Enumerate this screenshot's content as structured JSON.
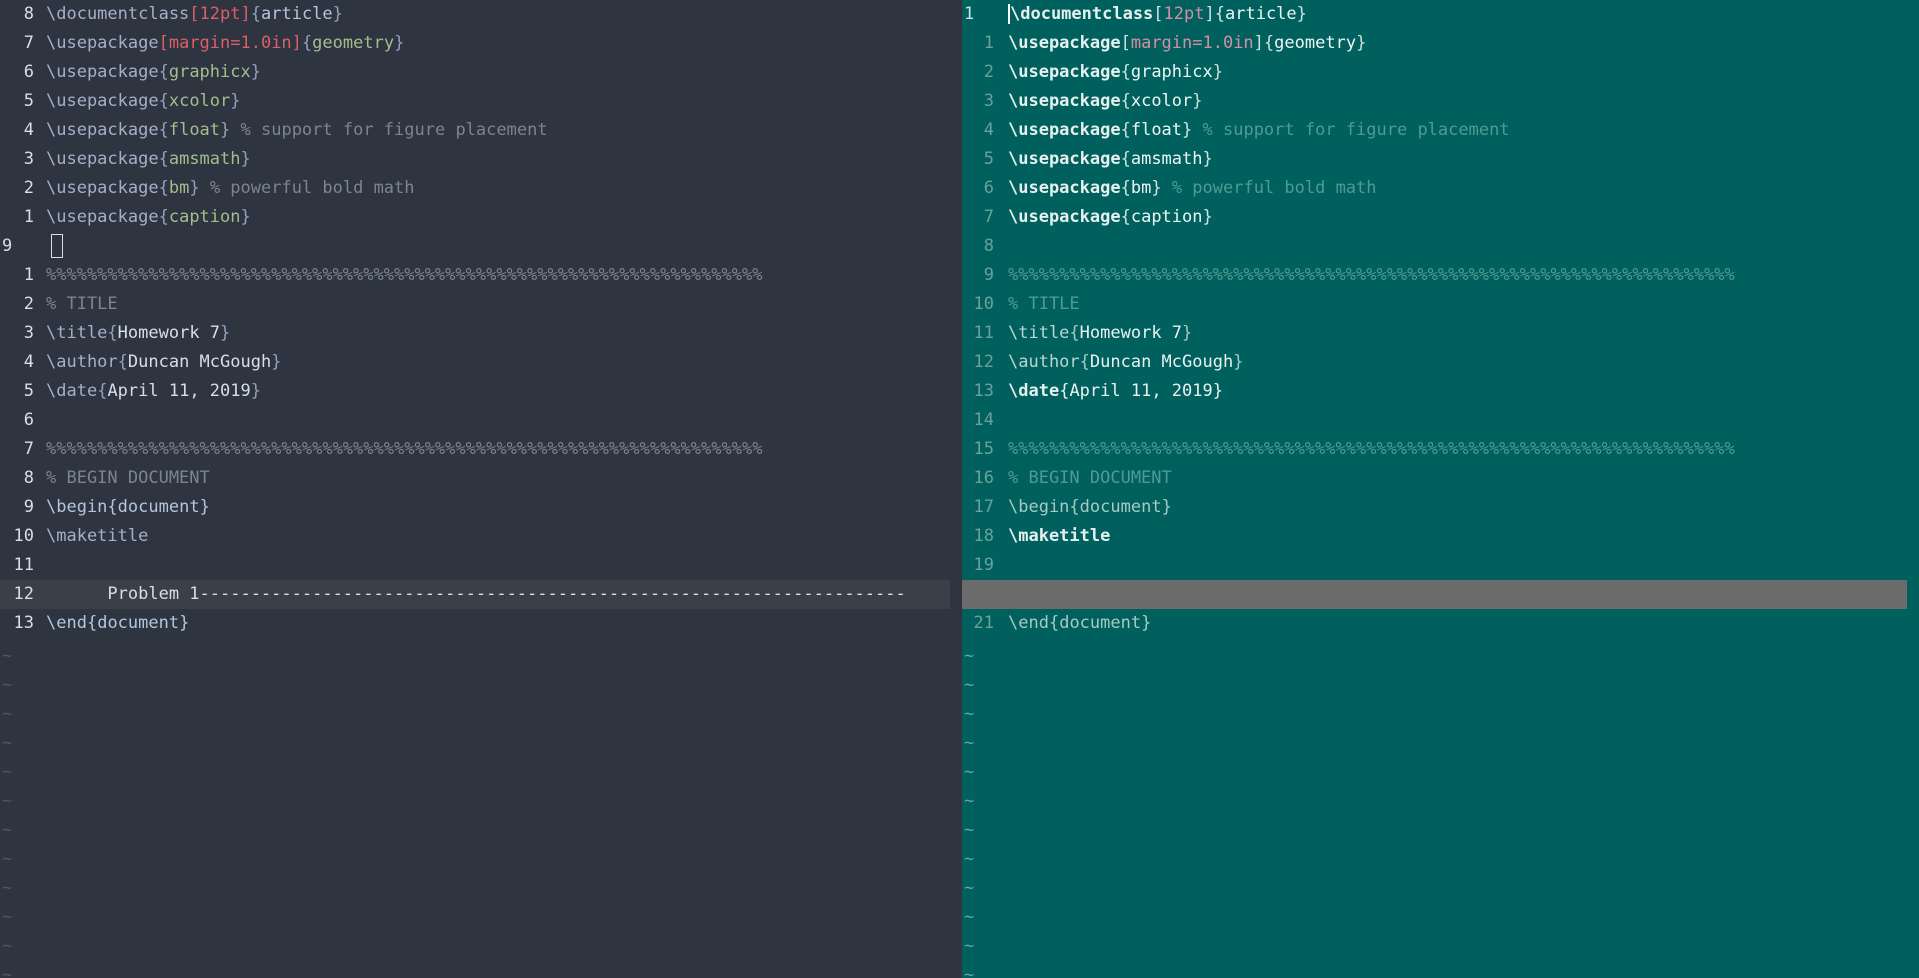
{
  "left_pane": {
    "lines": [
      {
        "num": "8",
        "kind": "pkg",
        "cmd": "\\documentclass",
        "opt": "12pt",
        "arg": "article"
      },
      {
        "num": "7",
        "kind": "pkg",
        "cmd": "\\usepackage",
        "opt": "margin=1.0in",
        "arg": "geometry"
      },
      {
        "num": "6",
        "kind": "pkg",
        "cmd": "\\usepackage",
        "arg": "graphicx"
      },
      {
        "num": "5",
        "kind": "pkg",
        "cmd": "\\usepackage",
        "arg": "xcolor"
      },
      {
        "num": "4",
        "kind": "pkg",
        "cmd": "\\usepackage",
        "arg": "float",
        "comment": "% support for figure placement"
      },
      {
        "num": "3",
        "kind": "pkg",
        "cmd": "\\usepackage",
        "arg": "amsmath"
      },
      {
        "num": "2",
        "kind": "pkg",
        "cmd": "\\usepackage",
        "arg": "bm",
        "comment": "% powerful bold math"
      },
      {
        "num": "1",
        "kind": "pkg",
        "cmd": "\\usepackage",
        "arg": "caption"
      },
      {
        "num": "9",
        "kind": "cursor"
      },
      {
        "num": "1",
        "kind": "comment",
        "text": "%%%%%%%%%%%%%%%%%%%%%%%%%%%%%%%%%%%%%%%%%%%%%%%%%%%%%%%%%%%%%%%%%%%%%%"
      },
      {
        "num": "2",
        "kind": "comment",
        "text": "% TITLE"
      },
      {
        "num": "3",
        "kind": "titlecmd",
        "cmd": "\\title",
        "arg": "Homework 7"
      },
      {
        "num": "4",
        "kind": "titlecmd",
        "cmd": "\\author",
        "arg": "Duncan McGough"
      },
      {
        "num": "5",
        "kind": "titlecmd",
        "cmd": "\\date",
        "arg": "April 11, 2019"
      },
      {
        "num": "6",
        "kind": "empty"
      },
      {
        "num": "7",
        "kind": "comment",
        "text": "%%%%%%%%%%%%%%%%%%%%%%%%%%%%%%%%%%%%%%%%%%%%%%%%%%%%%%%%%%%%%%%%%%%%%%"
      },
      {
        "num": "8",
        "kind": "comment",
        "text": "% BEGIN DOCUMENT"
      },
      {
        "num": "9",
        "kind": "env",
        "cmd": "\\begin",
        "arg": "document"
      },
      {
        "num": "10",
        "kind": "maketitle",
        "cmd": "\\maketitle"
      },
      {
        "num": "11",
        "kind": "empty"
      },
      {
        "num": "12",
        "kind": "fold",
        "text": "      Problem 1---------------------------------------------------------------------"
      },
      {
        "num": "13",
        "kind": "env",
        "cmd": "\\end",
        "arg": "document"
      }
    ],
    "tilde_count": 12,
    "tilde": "~"
  },
  "right_pane": {
    "lines": [
      {
        "num": "1",
        "abs": true,
        "kind": "pkg",
        "cmd": "\\documentclass",
        "opt": "12pt",
        "arg": "article",
        "cursor": true
      },
      {
        "num": "1",
        "kind": "pkg",
        "cmd": "\\usepackage",
        "opt": "margin=1.0in",
        "arg": "geometry"
      },
      {
        "num": "2",
        "kind": "pkg",
        "cmd": "\\usepackage",
        "arg": "graphicx"
      },
      {
        "num": "3",
        "kind": "pkg",
        "cmd": "\\usepackage",
        "arg": "xcolor"
      },
      {
        "num": "4",
        "kind": "pkg",
        "cmd": "\\usepackage",
        "arg": "float",
        "comment": "% support for figure placement"
      },
      {
        "num": "5",
        "kind": "pkg",
        "cmd": "\\usepackage",
        "arg": "amsmath"
      },
      {
        "num": "6",
        "kind": "pkg",
        "cmd": "\\usepackage",
        "arg": "bm",
        "comment": "% powerful bold math"
      },
      {
        "num": "7",
        "kind": "pkg",
        "cmd": "\\usepackage",
        "arg": "caption"
      },
      {
        "num": "8",
        "kind": "empty"
      },
      {
        "num": "9",
        "kind": "comment",
        "text": "%%%%%%%%%%%%%%%%%%%%%%%%%%%%%%%%%%%%%%%%%%%%%%%%%%%%%%%%%%%%%%%%%%%%%%%"
      },
      {
        "num": "10",
        "kind": "comment",
        "text": "% TITLE"
      },
      {
        "num": "11",
        "kind": "titlecmd",
        "cmd": "\\title",
        "arg": "Homework 7"
      },
      {
        "num": "12",
        "kind": "titlecmd",
        "cmd": "\\author",
        "arg": "Duncan McGough"
      },
      {
        "num": "13",
        "kind": "datebold",
        "cmd": "\\date",
        "arg": "April 11, 2019"
      },
      {
        "num": "14",
        "kind": "empty"
      },
      {
        "num": "15",
        "kind": "comment",
        "text": "%%%%%%%%%%%%%%%%%%%%%%%%%%%%%%%%%%%%%%%%%%%%%%%%%%%%%%%%%%%%%%%%%%%%%%%"
      },
      {
        "num": "16",
        "kind": "comment",
        "text": "% BEGIN DOCUMENT"
      },
      {
        "num": "17",
        "kind": "env",
        "cmd": "\\begin",
        "arg": "document"
      },
      {
        "num": "18",
        "kind": "maketitle",
        "cmd": "\\maketitle"
      },
      {
        "num": "19",
        "kind": "empty"
      },
      {
        "num": "",
        "kind": "fold"
      },
      {
        "num": "21",
        "kind": "env",
        "cmd": "\\end",
        "arg": "document"
      }
    ],
    "tilde_count": 12,
    "tilde": "~"
  },
  "colors": {
    "left_bg": "#2e3440",
    "right_bg": "#00605e",
    "left_cursorline": "#3b3f48",
    "right_foldline": "#6b6b6b"
  }
}
